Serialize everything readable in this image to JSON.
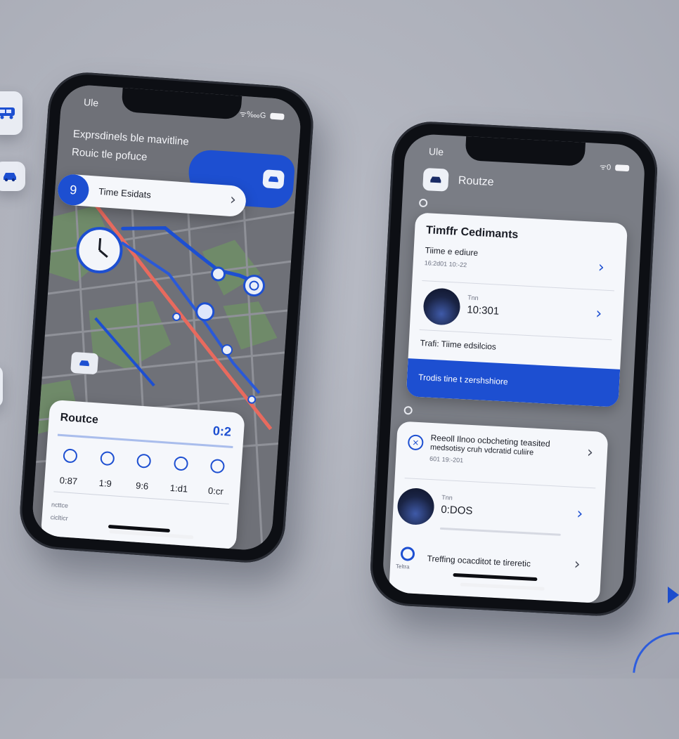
{
  "left_phone": {
    "status_time": "Ule",
    "status_signal": "ᯤ‱G",
    "header_line1": "Exprsdinels ble mavitline",
    "header_line2": "Rouic tle pofuce",
    "eta_badge": "9",
    "eta_title": "Time Esidats",
    "route_card": {
      "title": "Routce",
      "time": "0:2",
      "stops": [
        {
          "icon": "pin-icon",
          "time": "0:87"
        },
        {
          "icon": "pin-icon",
          "time": "1:9"
        },
        {
          "icon": "pin-icon",
          "time": "9:6"
        },
        {
          "icon": "pin-icon",
          "time": "1:d1"
        },
        {
          "icon": "pin-icon",
          "time": "0:cr"
        }
      ],
      "foot_line1": "ncttce",
      "foot_line2": "ciclticr"
    }
  },
  "right_phone": {
    "status_time": "Ule",
    "status_signal": "ᯤ0",
    "app_title": "Routze",
    "card1": {
      "title": "Timffr Cedimants",
      "row1_title": "Tiime e ediure",
      "row1_sub": "16:2d01 10:-22",
      "row2_label": "Tnn",
      "row2_time": "10:301",
      "row3_title": "Trafi: Tiime edsilcios",
      "banner": "Trodis tine t zershshiore"
    },
    "card2": {
      "row1_title": "Reeoll Ilnoo ocbcheting teasited",
      "row1_title2": "medsotisy cruh vdcratid culiire",
      "row1_sub": "601 19:-201",
      "row2_label": "Tnn",
      "row2_time": "0:DOS",
      "row3_icon_label": "Teltra",
      "row3_title": "Treffing ocacditot te tireretic"
    }
  },
  "colors": {
    "accent": "#1d4fd1",
    "route_red": "#e86a5e",
    "card_bg": "#f5f7fb",
    "map_green": "#6f8a69"
  }
}
